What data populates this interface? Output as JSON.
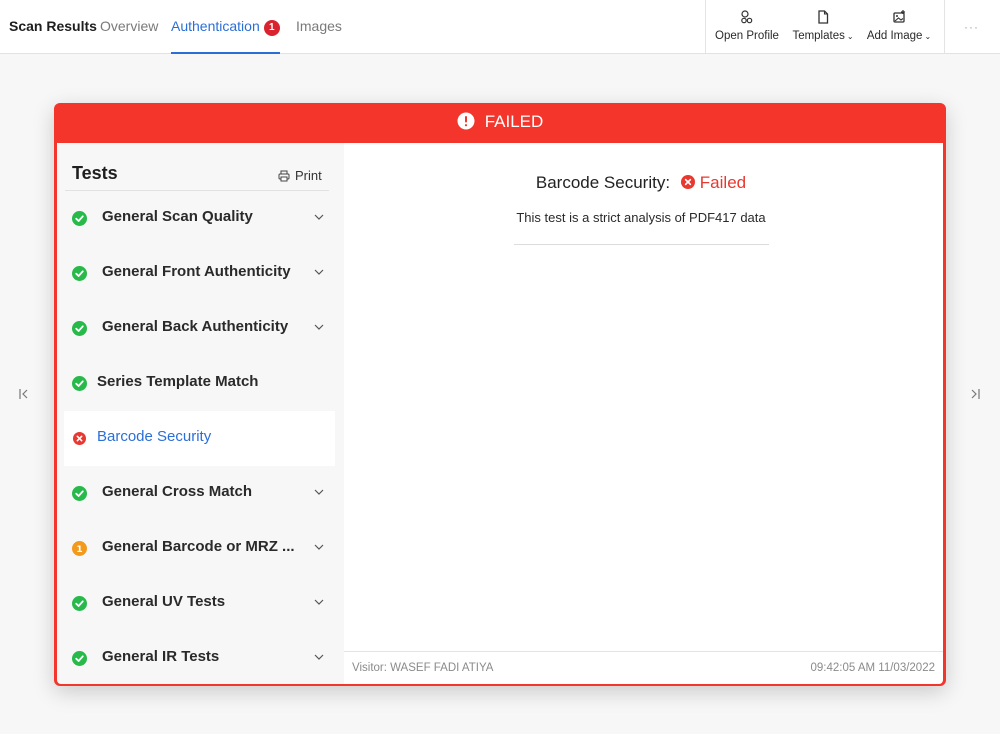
{
  "header": {
    "title": "Scan Results",
    "tabs": [
      {
        "label": "Overview"
      },
      {
        "label": "Authentication",
        "badge": "1"
      },
      {
        "label": "Images"
      }
    ],
    "toolbar": {
      "open_profile": "Open Profile",
      "templates": "Templates",
      "add_image": "Add Image",
      "more": "···"
    }
  },
  "status": {
    "text": "FAILED",
    "color": "#f3352b"
  },
  "tests": {
    "header": "Tests",
    "print_label": "Print",
    "items": [
      {
        "label": "General Scan Quality",
        "status": "passed",
        "expandable": true
      },
      {
        "label": "General Front Authenticity",
        "status": "passed",
        "expandable": true
      },
      {
        "label": "General Back Authenticity",
        "status": "passed",
        "expandable": true
      },
      {
        "label": "Series Template Match",
        "status": "passed",
        "expandable": false
      },
      {
        "label": "Barcode Security",
        "status": "failed",
        "expandable": false,
        "selected": true
      },
      {
        "label": "General Cross Match",
        "status": "passed",
        "expandable": true
      },
      {
        "label": "General Barcode or MRZ ...",
        "status": "warning",
        "badge": "1",
        "expandable": true
      },
      {
        "label": "General UV Tests",
        "status": "passed",
        "expandable": true
      },
      {
        "label": "General IR Tests",
        "status": "passed",
        "expandable": true
      }
    ]
  },
  "detail": {
    "title": "Barcode Security:",
    "status": "Failed",
    "description": "This test is a strict analysis of PDF417 data"
  },
  "footer": {
    "visitor": "Visitor: WASEF FADI ATIYA",
    "timestamp": "09:42:05 AM 11/03/2022"
  },
  "colors": {
    "passed": "#27b94a",
    "failed": "#e8382f",
    "warning": "#f39a1c",
    "accent": "#2b6fd6"
  }
}
